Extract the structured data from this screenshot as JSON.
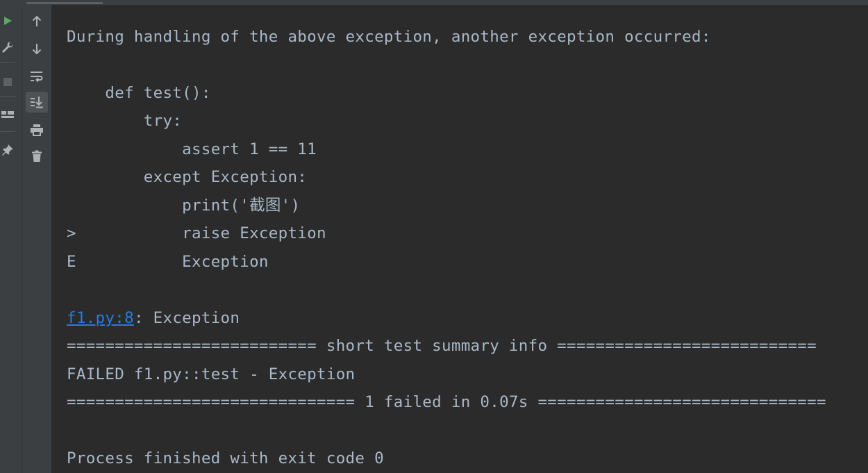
{
  "toolbar": {
    "left_icons": [
      "run-icon",
      "wrench-icon",
      "stop-icon",
      "layout-icon",
      "pin-icon"
    ],
    "icons": [
      "arrow-up-icon",
      "arrow-down-icon",
      "soft-wrap-icon",
      "scroll-to-end-icon",
      "print-icon",
      "trash-icon"
    ]
  },
  "console": {
    "lines": [
      "During handling of the above exception, another exception occurred:",
      "",
      "    def test():",
      "        try:",
      "            assert 1 == 11",
      "        except Exception:",
      "            print('截图')",
      ">           raise Exception",
      "E           Exception",
      "",
      {
        "link": "f1.py:8",
        "rest": ": Exception"
      },
      "========================== short test summary info ===========================",
      "FAILED f1.py::test - Exception",
      "============================== 1 failed in 0.07s ==============================",
      "",
      "Process finished with exit code 0"
    ]
  },
  "colors": {
    "background": "#2b2b2b",
    "text": "#a9b7c6",
    "link": "#287bde",
    "run_green": "#59a869",
    "icon": "#afb1b3"
  }
}
